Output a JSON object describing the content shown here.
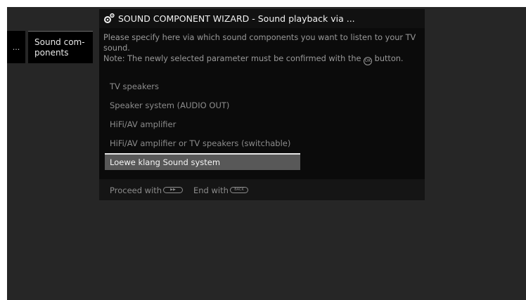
{
  "breadcrumb": {
    "ellipsis": "...",
    "current": "Sound com-ponents"
  },
  "dialog": {
    "title": "SOUND COMPONENT WIZARD - Sound playback via ...",
    "description_line1": "Please specify here via which sound components you want to listen to your TV",
    "description_line2": "sound.",
    "note_before": "Note: The newly selected parameter must be confirmed with the",
    "ok_label": "OK",
    "note_after": "button.",
    "options": [
      {
        "label": "TV speakers",
        "selected": false
      },
      {
        "label": "Speaker system (AUDIO OUT)",
        "selected": false
      },
      {
        "label": "HiFi/AV amplifier",
        "selected": false
      },
      {
        "label": "HiFi/AV amplifier or TV speakers (switchable)",
        "selected": false
      },
      {
        "label": "Loewe klang Sound system",
        "selected": true
      }
    ],
    "footer": {
      "proceed_label": "Proceed with",
      "proceed_key": "▶▶",
      "end_label": "End with",
      "end_key": "BACK"
    }
  },
  "colors": {
    "background": "#262626",
    "dialog": "#0b0b0b",
    "selected": "#585858",
    "text_dim": "#8c8c8c",
    "text_bright": "#f2f2f2"
  },
  "icons": {
    "title": "gear-icon",
    "proceed": "fast-forward-key-icon",
    "end": "back-key-icon"
  }
}
